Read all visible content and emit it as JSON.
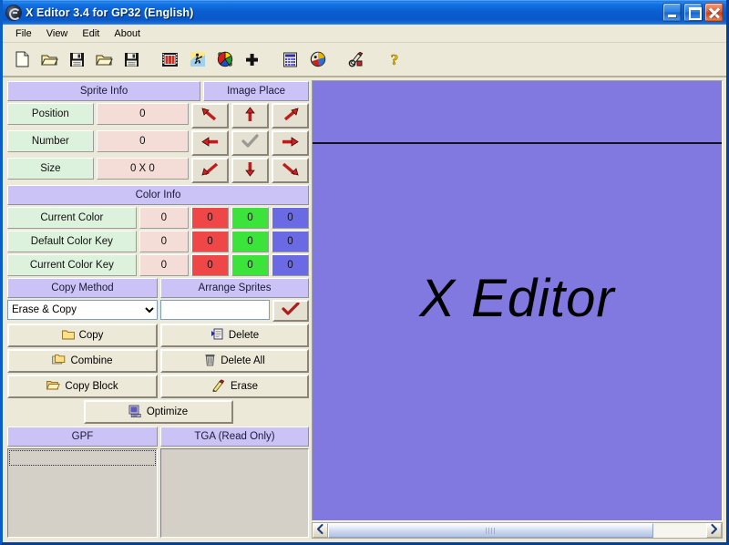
{
  "window": {
    "title": "X Editor 3.4 for GP32 (English)",
    "icon": "app-globe-icon",
    "minimize": "Minimize",
    "maximize": "Maximize",
    "close": "Close"
  },
  "menubar": {
    "items": [
      {
        "label": "File"
      },
      {
        "label": "View"
      },
      {
        "label": "Edit"
      },
      {
        "label": "About"
      }
    ]
  },
  "toolbar": {
    "groups": [
      {
        "buttons": [
          {
            "name": "new-file-icon",
            "tip": "New"
          },
          {
            "name": "open-folder-icon",
            "tip": "Open"
          },
          {
            "name": "save-disk-icon",
            "tip": "Save"
          },
          {
            "name": "open-folder-2-icon",
            "tip": "Open 2"
          },
          {
            "name": "save-disk-2-icon",
            "tip": "Save 2"
          }
        ]
      },
      {
        "buttons": [
          {
            "name": "filmstrip-icon",
            "tip": "Filmstrip"
          },
          {
            "name": "animation-run-icon",
            "tip": "Animate"
          },
          {
            "name": "color-wheel-icon",
            "tip": "Colors"
          },
          {
            "name": "plus-icon",
            "tip": "Add"
          }
        ]
      },
      {
        "buttons": [
          {
            "name": "calculator-icon",
            "tip": "Calculator"
          },
          {
            "name": "palette-icon",
            "tip": "Palette"
          }
        ]
      },
      {
        "buttons": [
          {
            "name": "tools-icon",
            "tip": "Tools"
          }
        ]
      },
      {
        "buttons": [
          {
            "name": "help-question-icon",
            "tip": "Help"
          }
        ]
      }
    ]
  },
  "sprite_info": {
    "header": "Sprite Info",
    "rows": [
      {
        "label": "Position",
        "value": "0"
      },
      {
        "label": "Number",
        "value": "0"
      },
      {
        "label": "Size",
        "value": "0 X 0"
      }
    ]
  },
  "image_place": {
    "header": "Image Place",
    "buttons": [
      {
        "name": "arrow-up-left-button",
        "glyph": "up-left-arrow-icon"
      },
      {
        "name": "arrow-up-button",
        "glyph": "up-arrow-icon"
      },
      {
        "name": "arrow-up-right-button",
        "glyph": "up-right-arrow-icon"
      },
      {
        "name": "arrow-left-button",
        "glyph": "left-arrow-icon"
      },
      {
        "name": "center-confirm-button",
        "glyph": "checkmark-icon"
      },
      {
        "name": "arrow-right-button",
        "glyph": "right-arrow-icon"
      },
      {
        "name": "arrow-down-left-button",
        "glyph": "down-left-arrow-icon"
      },
      {
        "name": "arrow-down-button",
        "glyph": "down-arrow-icon"
      },
      {
        "name": "arrow-down-right-button",
        "glyph": "down-right-arrow-icon"
      }
    ]
  },
  "color_info": {
    "header": "Color Info",
    "rows": [
      {
        "label": "Current Color",
        "index": "0",
        "r": "0",
        "g": "0",
        "b": "0"
      },
      {
        "label": "Default Color Key",
        "index": "0",
        "r": "0",
        "g": "0",
        "b": "0"
      },
      {
        "label": "Current Color Key",
        "index": "0",
        "r": "0",
        "g": "0",
        "b": "0"
      }
    ],
    "swatch_colors": {
      "r": "#ef4747",
      "g": "#3be33b",
      "b": "#6a6ae4"
    }
  },
  "copy_method": {
    "header": "Copy Method",
    "selected": "Erase & Copy",
    "options": [
      "Erase & Copy"
    ]
  },
  "arrange_sprites": {
    "header": "Arrange Sprites",
    "value": "",
    "placeholder": "",
    "apply_icon": "red-checkmark-icon"
  },
  "actions": {
    "buttons": [
      {
        "label": "Copy",
        "icon": "folder-icon",
        "name": "copy-button"
      },
      {
        "label": "Delete",
        "icon": "delete-pages-icon",
        "name": "delete-button"
      },
      {
        "label": "Combine",
        "icon": "folders-stack-icon",
        "name": "combine-button"
      },
      {
        "label": "Delete All",
        "icon": "trash-can-icon",
        "name": "delete-all-button"
      },
      {
        "label": "Copy Block",
        "icon": "folder-open-icon",
        "name": "copy-block-button"
      },
      {
        "label": "Erase",
        "icon": "eraser-pencil-icon",
        "name": "erase-button"
      }
    ],
    "optimize": {
      "label": "Optimize",
      "icon": "optimize-monitor-icon",
      "name": "optimize-button"
    }
  },
  "file_lists": {
    "gpf": {
      "header": "GPF",
      "items": []
    },
    "tga": {
      "header": "TGA (Read Only)",
      "items": []
    }
  },
  "canvas": {
    "watermark": "X Editor",
    "background_color": "#8178e0",
    "divider_color": "#12121e"
  },
  "scrollbar": {
    "left_arrow": "left-chevron-icon",
    "right_arrow": "right-chevron-icon",
    "thumb_grip": "grip-dots"
  }
}
